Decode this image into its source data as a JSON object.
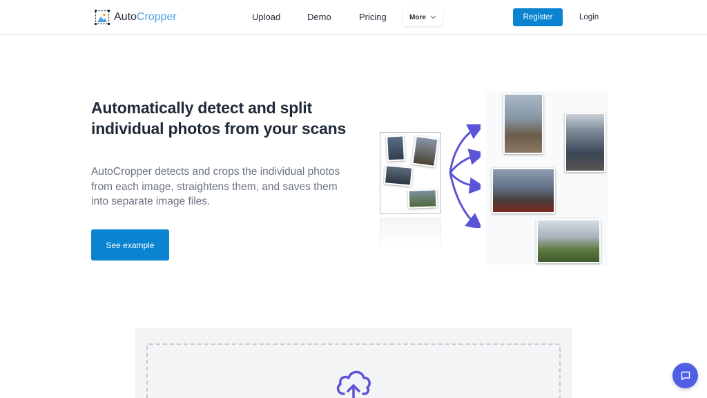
{
  "header": {
    "logo_part1": "Auto",
    "logo_part2": "Cropper",
    "nav": [
      "Upload",
      "Demo",
      "Pricing"
    ],
    "more_label": "More",
    "register_label": "Register",
    "login_label": "Login"
  },
  "hero": {
    "title": "Automatically detect and split individual photos from your scans",
    "description": "AutoCropper detects and crops the individual photos from each image, straightens them, and saves them into separate image files.",
    "cta_label": "See example"
  },
  "colors": {
    "primary": "#0a84d1",
    "logo_accent": "#4b9fe0",
    "arrow": "#5b54d6",
    "chat": "#4f5fe4"
  },
  "icons": {
    "upload": "cloud-upload-icon",
    "chat": "chat-bubble-icon",
    "more": "chevron-down-icon"
  }
}
